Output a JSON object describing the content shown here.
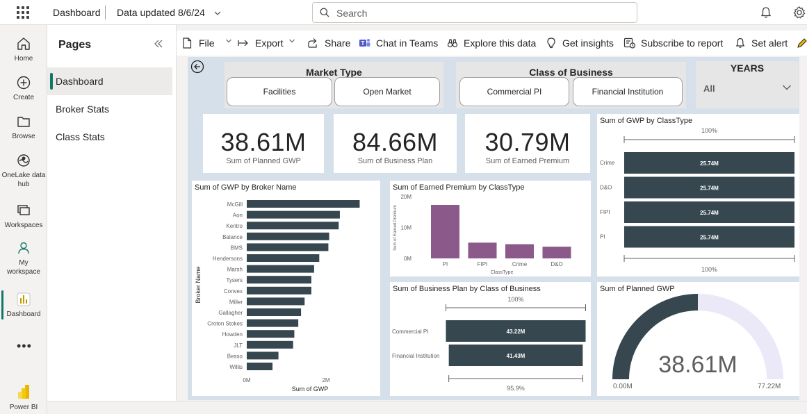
{
  "topbar": {
    "title": "Dashboard",
    "data_updated": "Data updated 8/6/24",
    "search_placeholder": "Search"
  },
  "leftnav": {
    "items": [
      {
        "label": "Home",
        "icon": "home-icon"
      },
      {
        "label": "Create",
        "icon": "plus-circle-icon"
      },
      {
        "label": "Browse",
        "icon": "folder-icon"
      },
      {
        "label": "OneLake data hub",
        "icon": "onelake-icon"
      },
      {
        "label": "Workspaces",
        "icon": "workspaces-icon"
      },
      {
        "label": "My workspace",
        "icon": "person-icon"
      },
      {
        "label": "Dashboard",
        "icon": "bar-chart-icon"
      },
      {
        "label": "Power BI",
        "icon": "powerbi-logo-icon"
      }
    ],
    "more": "•••"
  },
  "pages": {
    "title": "Pages",
    "items": [
      "Dashboard",
      "Broker Stats",
      "Class Stats"
    ],
    "active": "Dashboard"
  },
  "toolbar": {
    "file": "File",
    "export": "Export",
    "share": "Share",
    "chat": "Chat in Teams",
    "explore": "Explore this data",
    "insights": "Get insights",
    "subscribe": "Subscribe to report",
    "alert": "Set alert"
  },
  "slicers": {
    "market_type": {
      "title": "Market Type",
      "options": [
        "Facilities",
        "Open Market"
      ]
    },
    "class_of_business": {
      "title": "Class of Business",
      "options": [
        "Commercial PI",
        "Financial Institution"
      ]
    },
    "years": {
      "title": "YEARS",
      "value": "All"
    }
  },
  "cards": [
    {
      "value": "38.61M",
      "label": "Sum of Planned GWP"
    },
    {
      "value": "84.66M",
      "label": "Sum of Business Plan"
    },
    {
      "value": "30.79M",
      "label": "Sum of Earned Premium"
    }
  ],
  "colors": {
    "bar_dark": "#36474f",
    "bar_purple": "#8b5a8a",
    "gauge_bg": "#ebe8f8",
    "accent": "#117865"
  },
  "chart_data": [
    {
      "id": "gwp_by_broker",
      "type": "bar",
      "orientation": "horizontal",
      "title": "Sum of GWP by Broker Name",
      "xlabel": "Sum of GWP",
      "ylabel": "Broker Name",
      "categories": [
        "McGill",
        "Aon",
        "Kentro",
        "Balance",
        "BMS",
        "Hendersons",
        "Marsh",
        "Tysers",
        "Convex",
        "Miller",
        "Gallagher",
        "Croton Stokes",
        "Howden",
        "JLT",
        "Besso",
        "Willis"
      ],
      "values": [
        2.85,
        2.35,
        2.32,
        2.08,
        2.06,
        1.83,
        1.7,
        1.63,
        1.63,
        1.46,
        1.37,
        1.3,
        1.2,
        1.17,
        0.8,
        0.65
      ],
      "unit": "M",
      "xticks": [
        "0M",
        "2M"
      ],
      "xlim": [
        0,
        3
      ]
    },
    {
      "id": "earned_by_class",
      "type": "bar",
      "title": "Sum of Earned Premium by ClassType",
      "xlabel": "ClassType",
      "ylabel": "Sum of Earned Premium",
      "categories": [
        "PI",
        "FIPI",
        "Crime",
        "D&O"
      ],
      "values": [
        17.3,
        5.1,
        4.6,
        3.8
      ],
      "unit": "M",
      "yticks": [
        "0M",
        "10M",
        "20M"
      ],
      "ylim": [
        0,
        20
      ]
    },
    {
      "id": "gwp_by_classtype",
      "type": "bar",
      "orientation": "horizontal",
      "title": "Sum of GWP by ClassType",
      "categories": [
        "Crime",
        "D&O",
        "FIPI",
        "PI"
      ],
      "values": [
        25.74,
        25.74,
        25.74,
        25.74
      ],
      "labels": [
        "25.74M",
        "25.74M",
        "25.74M",
        "25.74M"
      ],
      "top_label": "100%",
      "bottom_label": "100%"
    },
    {
      "id": "plan_by_class",
      "type": "bar",
      "orientation": "horizontal",
      "title": "Sum of Business Plan by Class of Business",
      "categories": [
        "Commercial PI",
        "Financial Institution"
      ],
      "values": [
        43.22,
        41.43
      ],
      "labels": [
        "43.22M",
        "41.43M"
      ],
      "top_label": "100%",
      "bottom_label": "95.9%"
    },
    {
      "id": "planned_gauge",
      "type": "gauge",
      "title": "Sum of Planned GWP",
      "value": 38.61,
      "value_label": "38.61M",
      "min_label": "0.00M",
      "max_label": "77.22M",
      "min": 0,
      "max": 77.22
    }
  ]
}
